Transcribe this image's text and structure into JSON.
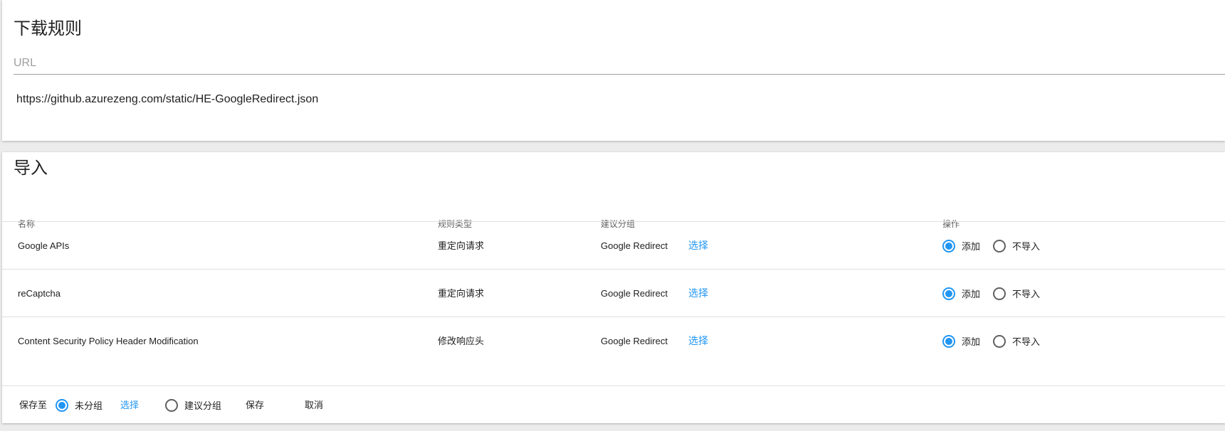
{
  "download_rules": {
    "title": "下载规则",
    "url_label": "URL",
    "url_value": "https://github.azurezeng.com/static/HE-GoogleRedirect.json"
  },
  "import": {
    "title": "导入",
    "columns": {
      "name": "名称",
      "rule_type": "规则类型",
      "suggested_group": "建议分组",
      "action": "操作"
    },
    "rows": [
      {
        "name": "Google APIs",
        "rule_type": "重定向请求",
        "suggested_group": "Google Redirect",
        "select_label": "选择",
        "add_label": "添加",
        "skip_label": "不导入",
        "action": "add"
      },
      {
        "name": "reCaptcha",
        "rule_type": "重定向请求",
        "suggested_group": "Google Redirect",
        "select_label": "选择",
        "add_label": "添加",
        "skip_label": "不导入",
        "action": "add"
      },
      {
        "name": "Content Security Policy Header Modification",
        "rule_type": "修改响应头",
        "suggested_group": "Google Redirect",
        "select_label": "选择",
        "add_label": "添加",
        "skip_label": "不导入",
        "action": "add"
      }
    ],
    "footer": {
      "save_to_label": "保存至",
      "ungrouped_label": "未分组",
      "select_label": "选择",
      "suggested_group_label": "建议分组",
      "save_label": "保存",
      "cancel_label": "取消",
      "selected": "ungrouped"
    }
  },
  "colors": {
    "accent": "#2196f3",
    "background": "#ececec",
    "card": "#ffffff"
  }
}
